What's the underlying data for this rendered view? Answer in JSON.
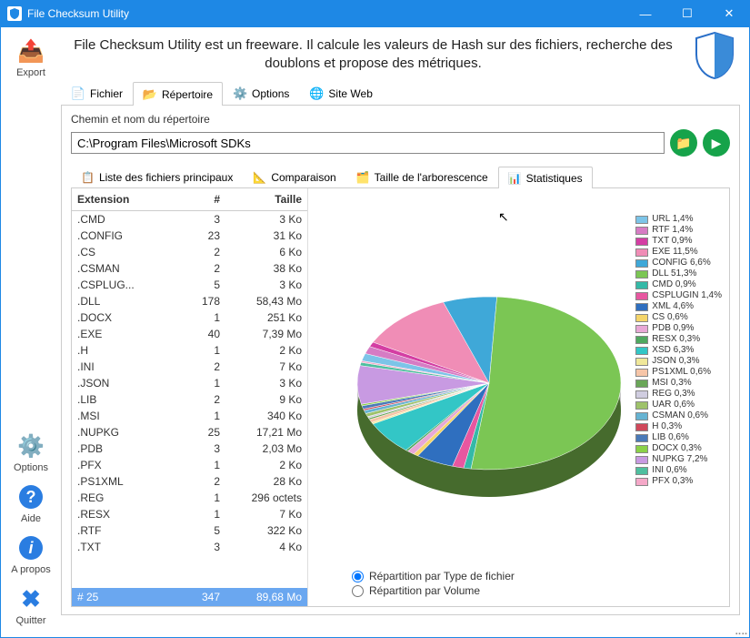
{
  "window": {
    "title": "File Checksum Utility"
  },
  "description": "File Checksum Utility est un freeware. Il calcule les valeurs de Hash sur des fichiers, recherche des doublons et propose des métriques.",
  "leftbar": {
    "export": "Export",
    "options": "Options",
    "aide": "Aide",
    "apropos": "A propos",
    "quitter": "Quitter"
  },
  "tabs1": {
    "fichier": "Fichier",
    "repertoire": "Répertoire",
    "options": "Options",
    "siteweb": "Site Web",
    "active": "repertoire"
  },
  "dir": {
    "label": "Chemin et nom du répertoire",
    "path": "C:\\Program Files\\Microsoft SDKs"
  },
  "tabs2": {
    "liste": "Liste des fichiers principaux",
    "comparaison": "Comparaison",
    "taille": "Taille de l'arborescence",
    "stats": "Statistiques",
    "active": "stats"
  },
  "table": {
    "headers": {
      "ext": "Extension",
      "count": "#",
      "size": "Taille"
    },
    "rows": [
      {
        "ext": ".CMD",
        "n": "3",
        "s": "3 Ko"
      },
      {
        "ext": ".CONFIG",
        "n": "23",
        "s": "31 Ko"
      },
      {
        "ext": ".CS",
        "n": "2",
        "s": "6 Ko"
      },
      {
        "ext": ".CSMAN",
        "n": "2",
        "s": "38 Ko"
      },
      {
        "ext": ".CSPLUG...",
        "n": "5",
        "s": "3 Ko"
      },
      {
        "ext": ".DLL",
        "n": "178",
        "s": "58,43 Mo"
      },
      {
        "ext": ".DOCX",
        "n": "1",
        "s": "251 Ko"
      },
      {
        "ext": ".EXE",
        "n": "40",
        "s": "7,39 Mo"
      },
      {
        "ext": ".H",
        "n": "1",
        "s": "2 Ko"
      },
      {
        "ext": ".INI",
        "n": "2",
        "s": "7 Ko"
      },
      {
        "ext": ".JSON",
        "n": "1",
        "s": "3 Ko"
      },
      {
        "ext": ".LIB",
        "n": "2",
        "s": "9 Ko"
      },
      {
        "ext": ".MSI",
        "n": "1",
        "s": "340 Ko"
      },
      {
        "ext": ".NUPKG",
        "n": "25",
        "s": "17,21 Mo"
      },
      {
        "ext": ".PDB",
        "n": "3",
        "s": "2,03 Mo"
      },
      {
        "ext": ".PFX",
        "n": "1",
        "s": "2 Ko"
      },
      {
        "ext": ".PS1XML",
        "n": "2",
        "s": "28 Ko"
      },
      {
        "ext": ".REG",
        "n": "1",
        "s": "296 octets"
      },
      {
        "ext": ".RESX",
        "n": "1",
        "s": "7 Ko"
      },
      {
        "ext": ".RTF",
        "n": "5",
        "s": "322 Ko"
      },
      {
        "ext": ".TXT",
        "n": "3",
        "s": "4 Ko"
      }
    ],
    "footer": {
      "label": "# 25",
      "n": "347",
      "s": "89,68 Mo"
    }
  },
  "radios": {
    "type": "Répartition par Type de fichier",
    "vol": "Répartition par Volume",
    "checked": "type"
  },
  "chart_data": {
    "type": "pie",
    "title": "",
    "series": [
      {
        "name": "URL",
        "value": 1.4,
        "color": "#7cc4e8"
      },
      {
        "name": "RTF",
        "value": 1.4,
        "color": "#d67cc4"
      },
      {
        "name": "TXT",
        "value": 0.9,
        "color": "#d43ea3"
      },
      {
        "name": "EXE",
        "value": 11.5,
        "color": "#f08db6"
      },
      {
        "name": "CONFIG",
        "value": 6.6,
        "color": "#3fa8d8"
      },
      {
        "name": "DLL",
        "value": 51.3,
        "color": "#7bc654"
      },
      {
        "name": "CMD",
        "value": 0.9,
        "color": "#34b9a7"
      },
      {
        "name": "CSPLUGIN",
        "value": 1.4,
        "color": "#e757a0"
      },
      {
        "name": "XML",
        "value": 4.6,
        "color": "#2f6fbf"
      },
      {
        "name": "CS",
        "value": 0.6,
        "color": "#f5d56a"
      },
      {
        "name": "PDB",
        "value": 0.9,
        "color": "#e8a8d6"
      },
      {
        "name": "RESX",
        "value": 0.3,
        "color": "#4fa85f"
      },
      {
        "name": "XSD",
        "value": 6.3,
        "color": "#33c6c6"
      },
      {
        "name": "JSON",
        "value": 0.3,
        "color": "#f0e89a"
      },
      {
        "name": "PS1XML",
        "value": 0.6,
        "color": "#f6c5a8"
      },
      {
        "name": "MSI",
        "value": 0.3,
        "color": "#6aa658"
      },
      {
        "name": "REG",
        "value": 0.3,
        "color": "#d0cde0"
      },
      {
        "name": "UAR",
        "value": 0.6,
        "color": "#9ec26a"
      },
      {
        "name": "CSMAN",
        "value": 0.6,
        "color": "#66b3d2"
      },
      {
        "name": "H",
        "value": 0.3,
        "color": "#d0485a"
      },
      {
        "name": "LIB",
        "value": 0.6,
        "color": "#4a7ab8"
      },
      {
        "name": "DOCX",
        "value": 0.3,
        "color": "#8bd148"
      },
      {
        "name": "NUPKG",
        "value": 7.2,
        "color": "#c89ae2"
      },
      {
        "name": "INI",
        "value": 0.6,
        "color": "#4fbf9f"
      },
      {
        "name": "PFX",
        "value": 0.3,
        "color": "#f5a8c8"
      }
    ]
  }
}
